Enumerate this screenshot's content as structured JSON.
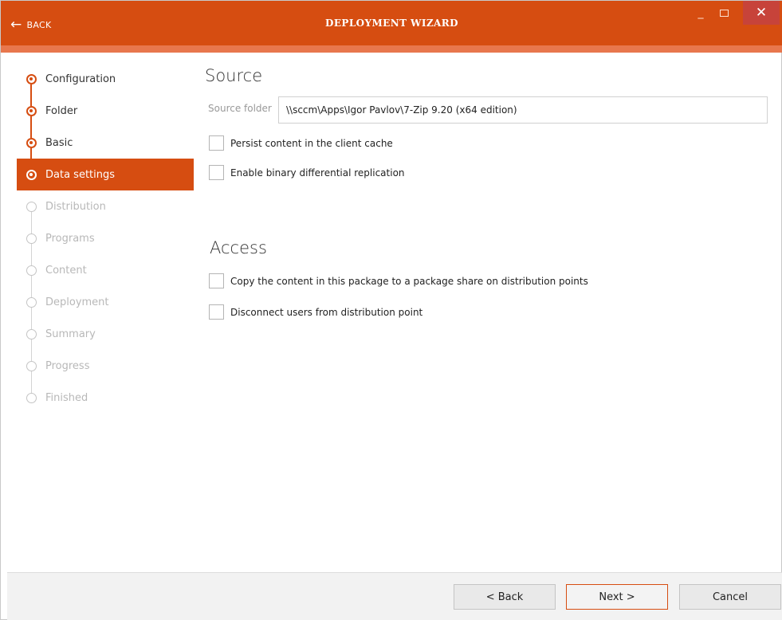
{
  "window": {
    "title": "DEPLOYMENT WIZARD",
    "back_label": "BACK",
    "back_icon": "arrow-left-icon",
    "minimize_glyph": "_",
    "close_glyph": "✕",
    "accent_color": "#d64d11"
  },
  "steps": [
    {
      "label": "Configuration",
      "state": "done"
    },
    {
      "label": "Folder",
      "state": "done"
    },
    {
      "label": "Basic",
      "state": "done"
    },
    {
      "label": "Data settings",
      "state": "active"
    },
    {
      "label": "Distribution",
      "state": "pending"
    },
    {
      "label": "Programs",
      "state": "pending"
    },
    {
      "label": "Content",
      "state": "pending"
    },
    {
      "label": "Deployment",
      "state": "pending"
    },
    {
      "label": "Summary",
      "state": "pending"
    },
    {
      "label": "Progress",
      "state": "pending"
    },
    {
      "label": "Finished",
      "state": "pending"
    }
  ],
  "source": {
    "title": "Source",
    "folder_label": "Source folder",
    "folder_value": "\\\\sccm\\Apps\\Igor Pavlov\\7-Zip 9.20 (x64 edition)",
    "options": [
      {
        "label": "Persist content in the client cache",
        "checked": false
      },
      {
        "label": "Enable binary differential replication",
        "checked": false
      }
    ]
  },
  "access": {
    "title": "Access",
    "options": [
      {
        "label": "Copy the content in this package to a package share on distribution points",
        "checked": false
      },
      {
        "label": "Disconnect users from distribution point",
        "checked": false
      }
    ]
  },
  "footer": {
    "back_label": "< Back",
    "next_label": "Next >",
    "cancel_label": "Cancel"
  }
}
